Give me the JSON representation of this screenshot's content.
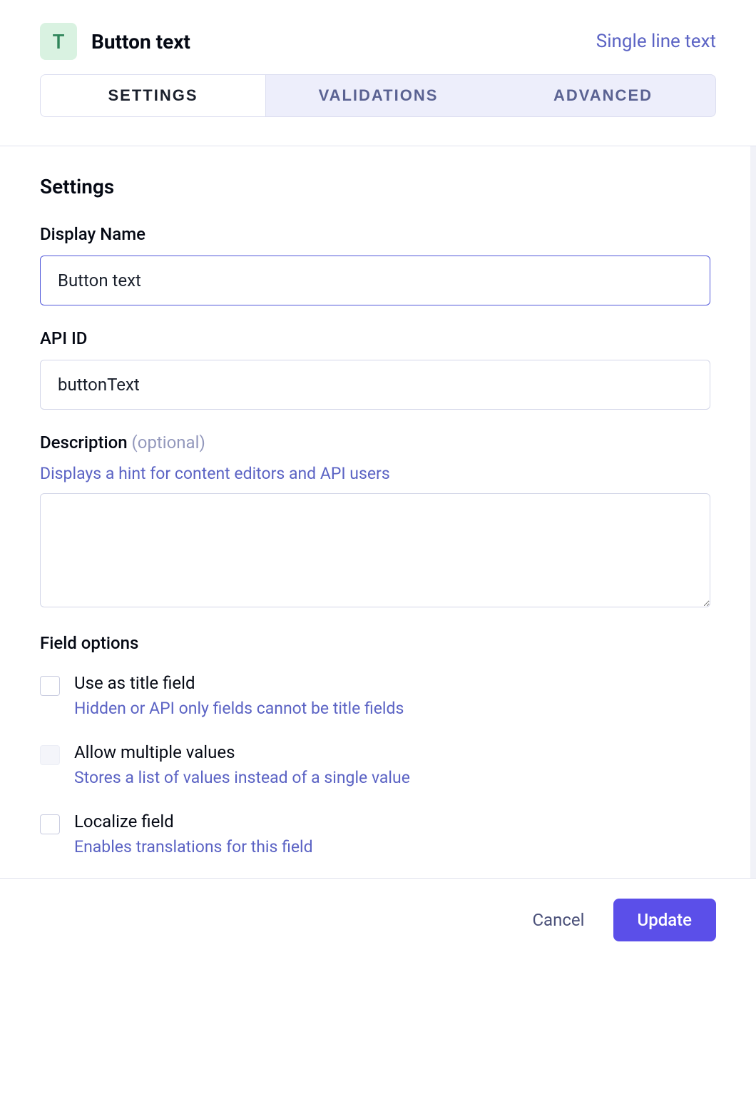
{
  "header": {
    "icon_letter": "T",
    "title": "Button text",
    "type_label": "Single line text"
  },
  "tabs": [
    {
      "label": "SETTINGS",
      "active": true
    },
    {
      "label": "VALIDATIONS",
      "active": false
    },
    {
      "label": "ADVANCED",
      "active": false
    }
  ],
  "settings": {
    "section_title": "Settings",
    "display_name": {
      "label": "Display Name",
      "value": "Button text"
    },
    "api_id": {
      "label": "API ID",
      "value": "buttonText"
    },
    "description": {
      "label": "Description",
      "optional_label": "(optional)",
      "hint": "Displays a hint for content editors and API users",
      "value": ""
    },
    "field_options_title": "Field options",
    "options": [
      {
        "title": "Use as title field",
        "desc": "Hidden or API only fields cannot be title fields",
        "checked": false,
        "disabled": false
      },
      {
        "title": "Allow multiple values",
        "desc": "Stores a list of values instead of a single value",
        "checked": false,
        "disabled": true
      },
      {
        "title": "Localize field",
        "desc": "Enables translations for this field",
        "checked": false,
        "disabled": false
      }
    ]
  },
  "footer": {
    "cancel": "Cancel",
    "update": "Update"
  }
}
